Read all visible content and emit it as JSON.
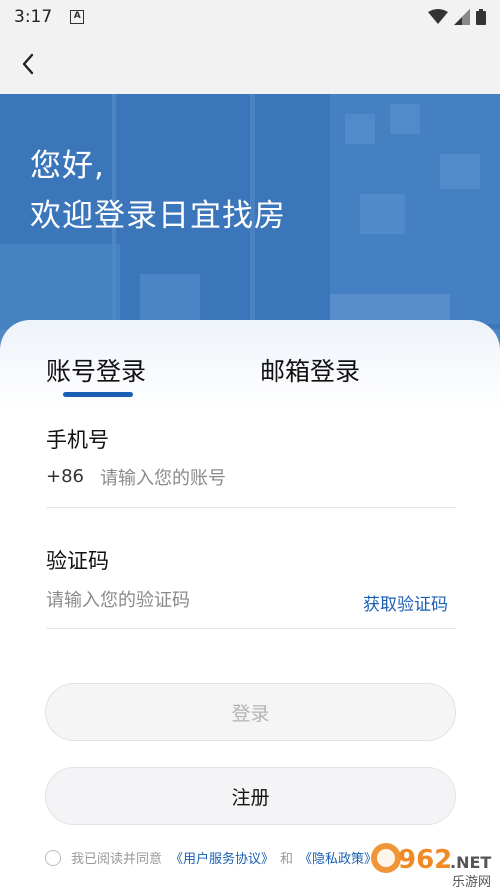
{
  "status_bar": {
    "time": "3:17",
    "notif_icon": "A"
  },
  "hero": {
    "greeting": "您好,",
    "title": "欢迎登录日宜找房"
  },
  "tabs": {
    "account": "账号登录",
    "email": "邮箱登录"
  },
  "phone": {
    "label": "手机号",
    "country_code": "+86",
    "placeholder": "请输入您的账号"
  },
  "code": {
    "label": "验证码",
    "placeholder": "请输入您的验证码",
    "get_code": "获取验证码"
  },
  "buttons": {
    "login": "登录",
    "register": "注册"
  },
  "agreement": {
    "prefix": "我已阅读并同意",
    "user_agreement": "《用户服务协议》",
    "and": "和",
    "privacy": "《隐私政策》"
  },
  "watermark": {
    "main": "962",
    "suffix": ".NET",
    "sub": "乐游网"
  },
  "colors": {
    "accent": "#1a5fb4",
    "hero_bg": "#3f7bc0"
  }
}
